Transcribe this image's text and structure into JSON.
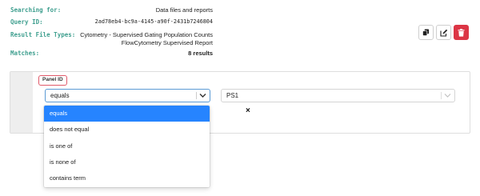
{
  "summary": {
    "searching_for_label": "Searching for:",
    "searching_for_value": "Data files and reports",
    "query_id_label": "Query ID:",
    "query_id_value": "2ad78eb4-bc9a-4145-a90f-2431b7246804",
    "result_types_label": "Result File Types:",
    "result_types_values": [
      "Cytometry - Supervised Gating Population Counts",
      "FlowCytometry Supervised Report"
    ],
    "matches_label": "Matches:",
    "matches_value": "8 results"
  },
  "actions": [
    {
      "icon": "copy-icon"
    },
    {
      "icon": "edit-icon"
    },
    {
      "icon": "trash-icon",
      "color": "#dc3545"
    }
  ],
  "filter": {
    "field_label": "Panel ID",
    "operator_value": "equals",
    "value": "PS1",
    "remove_glyph": "×"
  },
  "operator_options": [
    {
      "label": "equals",
      "selected": true
    },
    {
      "label": "does not equal",
      "selected": false
    },
    {
      "label": "is one of",
      "selected": false
    },
    {
      "label": "is none of",
      "selected": false
    },
    {
      "label": "contains term",
      "selected": false
    }
  ],
  "colors": {
    "label_teal": "#3f9f8f",
    "focus_blue": "#5b9bd5",
    "selected_blue": "#2684ff",
    "danger_red": "#dc3545",
    "tag_border": "#e05a6a"
  }
}
